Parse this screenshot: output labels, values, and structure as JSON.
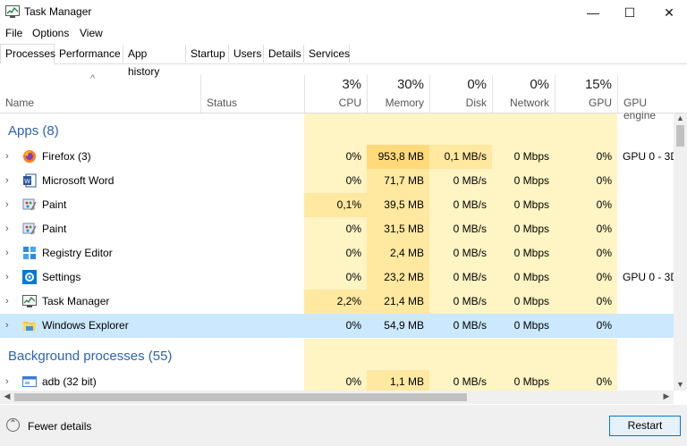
{
  "window": {
    "title": "Task Manager",
    "minimize": "—",
    "maximize": "☐",
    "close": "✕"
  },
  "menu": [
    "File",
    "Options",
    "View"
  ],
  "tabs": [
    "Processes",
    "Performance",
    "App history",
    "Startup",
    "Users",
    "Details",
    "Services"
  ],
  "header": {
    "sort_arrow": "^",
    "name": "Name",
    "status": "Status",
    "cpu": {
      "pct": "3%",
      "label": "CPU"
    },
    "memory": {
      "pct": "30%",
      "label": "Memory"
    },
    "disk": {
      "pct": "0%",
      "label": "Disk"
    },
    "network": {
      "pct": "0%",
      "label": "Network"
    },
    "gpu": {
      "pct": "15%",
      "label": "GPU"
    },
    "gpu_engine": "GPU engine"
  },
  "apps_section": "Apps (8)",
  "background_section": "Background processes (55)",
  "rows": [
    {
      "name": "Firefox (3)",
      "icon": "firefox-icon",
      "cpu": "0%",
      "memory": "953,8 MB",
      "disk": "0,1 MB/s",
      "network": "0 Mbps",
      "gpu": "0%",
      "gpu_engine": "GPU 0 - 3D"
    },
    {
      "name": "Microsoft Word",
      "icon": "word-icon",
      "cpu": "0%",
      "memory": "71,7 MB",
      "disk": "0 MB/s",
      "network": "0 Mbps",
      "gpu": "0%",
      "gpu_engine": ""
    },
    {
      "name": "Paint",
      "icon": "paint-icon",
      "cpu": "0,1%",
      "memory": "39,5 MB",
      "disk": "0 MB/s",
      "network": "0 Mbps",
      "gpu": "0%",
      "gpu_engine": ""
    },
    {
      "name": "Paint",
      "icon": "paint-icon",
      "cpu": "0%",
      "memory": "31,5 MB",
      "disk": "0 MB/s",
      "network": "0 Mbps",
      "gpu": "0%",
      "gpu_engine": ""
    },
    {
      "name": "Registry Editor",
      "icon": "registry-editor-icon",
      "cpu": "0%",
      "memory": "2,4 MB",
      "disk": "0 MB/s",
      "network": "0 Mbps",
      "gpu": "0%",
      "gpu_engine": ""
    },
    {
      "name": "Settings",
      "icon": "settings-icon",
      "cpu": "0%",
      "memory": "23,2 MB",
      "disk": "0 MB/s",
      "network": "0 Mbps",
      "gpu": "0%",
      "gpu_engine": "GPU 0 - 3D"
    },
    {
      "name": "Task Manager",
      "icon": "task-manager-icon",
      "cpu": "2,2%",
      "memory": "21,4 MB",
      "disk": "0 MB/s",
      "network": "0 Mbps",
      "gpu": "0%",
      "gpu_engine": ""
    },
    {
      "name": "Windows Explorer",
      "icon": "windows-explorer-icon",
      "cpu": "0%",
      "memory": "54,9 MB",
      "disk": "0 MB/s",
      "network": "0 Mbps",
      "gpu": "0%",
      "gpu_engine": ""
    }
  ],
  "bg_rows": [
    {
      "name": "adb (32 bit)",
      "icon": "adb-icon",
      "cpu": "0%",
      "memory": "1,1 MB",
      "disk": "0 MB/s",
      "network": "0 Mbps",
      "gpu": "0%",
      "gpu_engine": ""
    }
  ],
  "footer": {
    "fewer_details": "Fewer details",
    "restart": "Restart"
  },
  "colors": {
    "heat_light": "#fff4c4",
    "heat_mid": "#ffe8a0",
    "heat_strong": "#ffd97a",
    "section_text": "#2b63b5",
    "selected_row": "#cce8ff"
  }
}
